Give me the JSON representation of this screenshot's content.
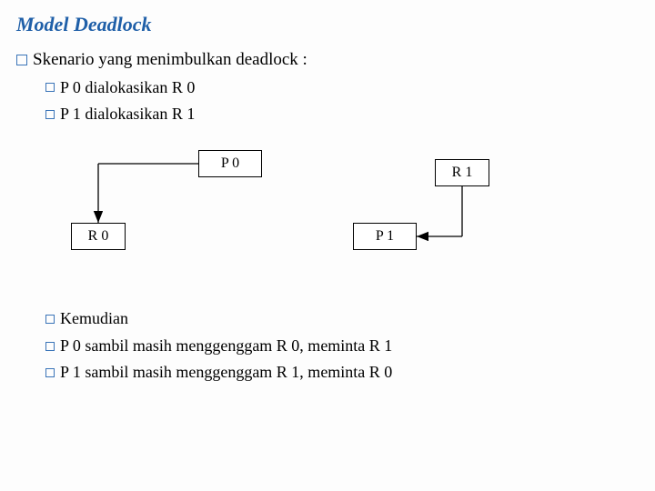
{
  "title": "Model Deadlock",
  "intro": "Skenario yang menimbulkan deadlock :",
  "alloc": {
    "l1": "P 0 dialokasikan R 0",
    "l2": "P 1 dialokasikan R 1"
  },
  "diagram": {
    "p0": "P 0",
    "r0": "R 0",
    "r1": "R 1",
    "p1": "P 1"
  },
  "then": {
    "l1": "Kemudian",
    "l2": "P 0 sambil masih menggenggam R 0, meminta R 1",
    "l3": "P 1 sambil masih menggenggam R 1, meminta R 0"
  }
}
